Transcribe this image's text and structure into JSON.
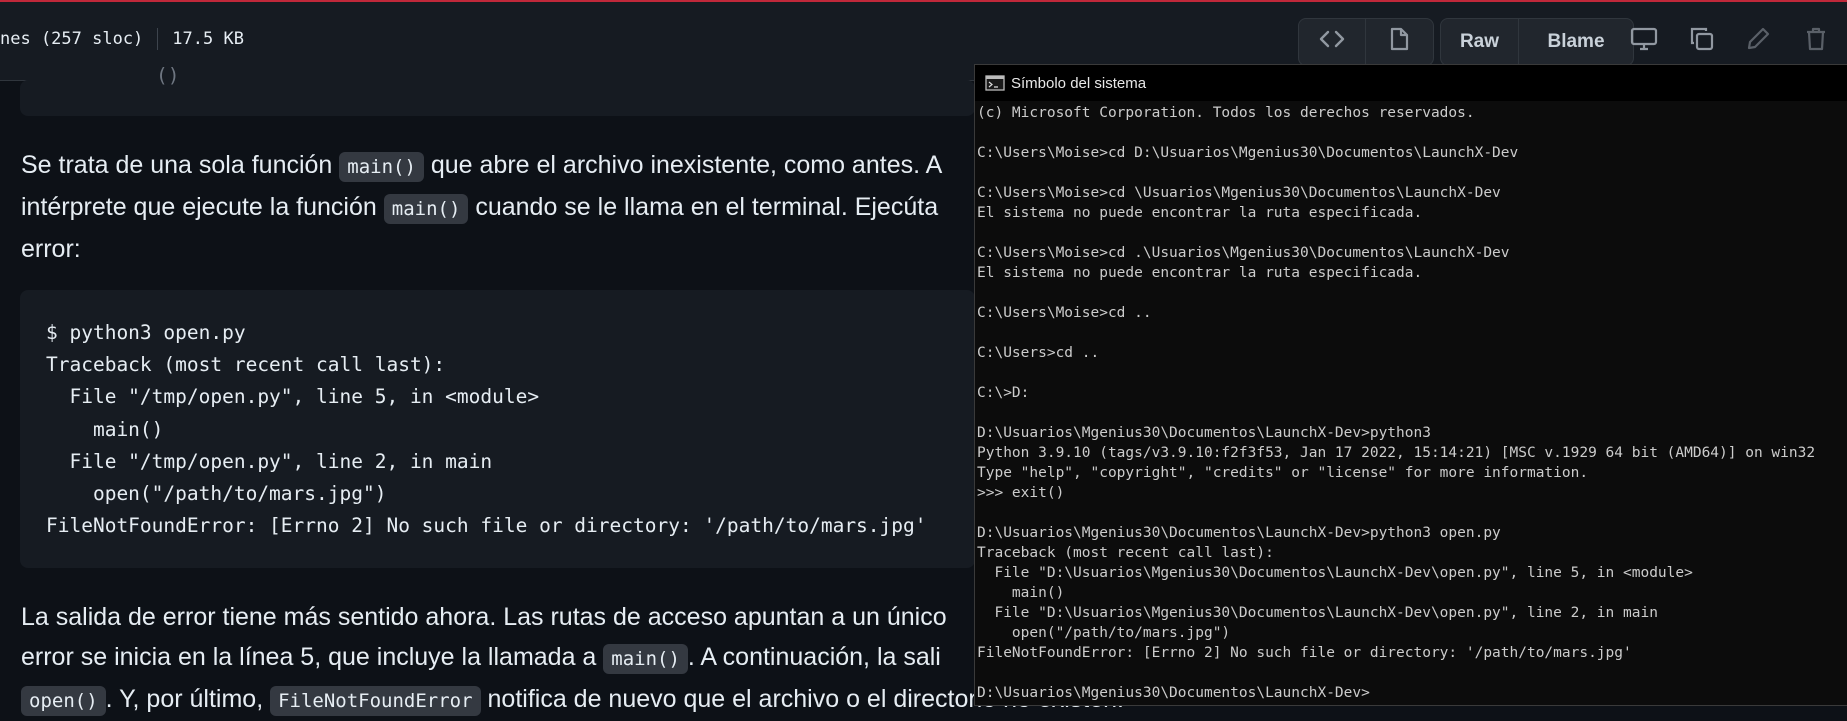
{
  "header": {
    "lines_sloc": "nes (257 sloc)",
    "size": "17.5 KB",
    "raw_label": "Raw",
    "blame_label": "Blame"
  },
  "prose": {
    "p1": {
      "line1_before": "Se trata de una sola función ",
      "line1_code": "main()",
      "line1_after": " que abre el archivo inexistente, como antes. A",
      "line2_before": "intérprete que ejecute la función ",
      "line2_code": "main()",
      "line2_after": " cuando se le llama en el terminal. Ejecúta",
      "line3": "error:"
    },
    "p2": {
      "line1": "La salida de error tiene más sentido ahora. Las rutas de acceso apuntan a un único",
      "line2_before": "error se inicia en la línea 5, que incluye la llamada a ",
      "line2_code": "main()",
      "line2_after": ". A continuación, la sali",
      "line3_code1": "open()",
      "line3_mid": ". Y, por último, ",
      "line3_code2": "FileNotFoundError",
      "line3_after": " notifica de nuevo que el archivo o el directorio no existen."
    }
  },
  "code": {
    "top_fragment": "()",
    "lines": [
      "$ python3 open.py",
      "Traceback (most recent call last):",
      "  File \"/tmp/open.py\", line 5, in <module>",
      "    main()",
      "  File \"/tmp/open.py\", line 2, in main",
      "    open(\"/path/to/mars.jpg\")",
      "FileNotFoundError: [Errno 2] No such file or directory: '/path/to/mars.jpg'"
    ]
  },
  "cmd": {
    "title": "Símbolo del sistema",
    "icon_text": "C:\\",
    "lines": [
      "(c) Microsoft Corporation. Todos los derechos reservados.",
      "",
      "C:\\Users\\Moise>cd D:\\Usuarios\\Mgenius30\\Documentos\\LaunchX-Dev",
      "",
      "C:\\Users\\Moise>cd \\Usuarios\\Mgenius30\\Documentos\\LaunchX-Dev",
      "El sistema no puede encontrar la ruta especificada.",
      "",
      "C:\\Users\\Moise>cd .\\Usuarios\\Mgenius30\\Documentos\\LaunchX-Dev",
      "El sistema no puede encontrar la ruta especificada.",
      "",
      "C:\\Users\\Moise>cd ..",
      "",
      "C:\\Users>cd ..",
      "",
      "C:\\>D:",
      "",
      "D:\\Usuarios\\Mgenius30\\Documentos\\LaunchX-Dev>python3",
      "Python 3.9.10 (tags/v3.9.10:f2f3f53, Jan 17 2022, 15:14:21) [MSC v.1929 64 bit (AMD64)] on win32",
      "Type \"help\", \"copyright\", \"credits\" or \"license\" for more information.",
      ">>> exit()",
      "",
      "D:\\Usuarios\\Mgenius30\\Documentos\\LaunchX-Dev>python3 open.py",
      "Traceback (most recent call last):",
      "  File \"D:\\Usuarios\\Mgenius30\\Documentos\\LaunchX-Dev\\open.py\", line 5, in <module>",
      "    main()",
      "  File \"D:\\Usuarios\\Mgenius30\\Documentos\\LaunchX-Dev\\open.py\", line 2, in main",
      "    open(\"/path/to/mars.jpg\")",
      "FileNotFoundError: [Errno 2] No such file or directory: '/path/to/mars.jpg'",
      "",
      "D:\\Usuarios\\Mgenius30\\Documentos\\LaunchX-Dev>"
    ]
  },
  "icons": {
    "code_view": "code-icon",
    "file_view": "file-icon",
    "display": "desktop-icon",
    "copy": "copy-icon",
    "edit": "pencil-icon",
    "delete": "trash-icon"
  },
  "colors": {
    "page_bg": "#0d1117",
    "header_bg": "#161b22",
    "code_bg": "#161b22",
    "inline_code_bg": "#343941",
    "terminal_bg": "#0c0c0c",
    "terminal_text": "#cccccc",
    "top_accent": "#c0283a"
  }
}
